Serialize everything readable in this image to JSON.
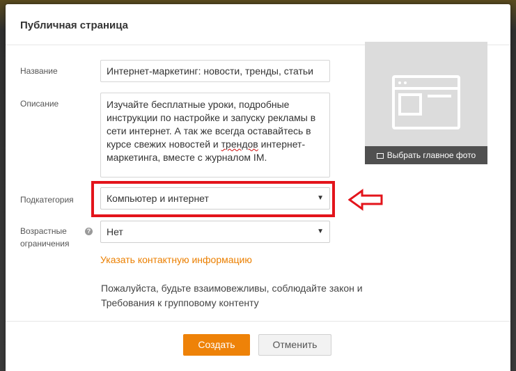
{
  "dialog": {
    "title": "Публичная страница"
  },
  "form": {
    "name_label": "Название",
    "name_value": "Интернет-маркетинг: новости, тренды, статьи",
    "description_label": "Описание",
    "description_part1": "Изучайте бесплатные уроки, подробные инструкции по настройке и запуску рекламы в сети интернет. А так же всегда оставайтесь в курсе свежих новостей и ",
    "description_misspelled": "трендов",
    "description_part2": " интернет-маркетинга, вместе с журналом IM.",
    "subcategory_label": "Подкатегория",
    "subcategory_value": "Компьютер и интернет",
    "age_label_line1": "Возрастные",
    "age_label_line2": "ограничения",
    "age_value": "Нет",
    "help_symbol": "?",
    "contact_link": "Указать контактную информацию",
    "policy_text": "Пожалуйста, будьте взаимовежливы, соблюдайте закон и Требования к групповому контенту"
  },
  "photo": {
    "choose_label": "Выбрать главное фото"
  },
  "buttons": {
    "create_label": "Создать",
    "cancel_label": "Отменить"
  },
  "colors": {
    "accent": "#ee8208",
    "link": "#eb7f00",
    "highlight": "#e3141b"
  },
  "icons": {
    "photo_placeholder": "browser-window-icon",
    "photo_button": "copy-icon",
    "select_arrow": "triangle-down-icon",
    "annotation_arrow": "arrow-left-icon"
  }
}
